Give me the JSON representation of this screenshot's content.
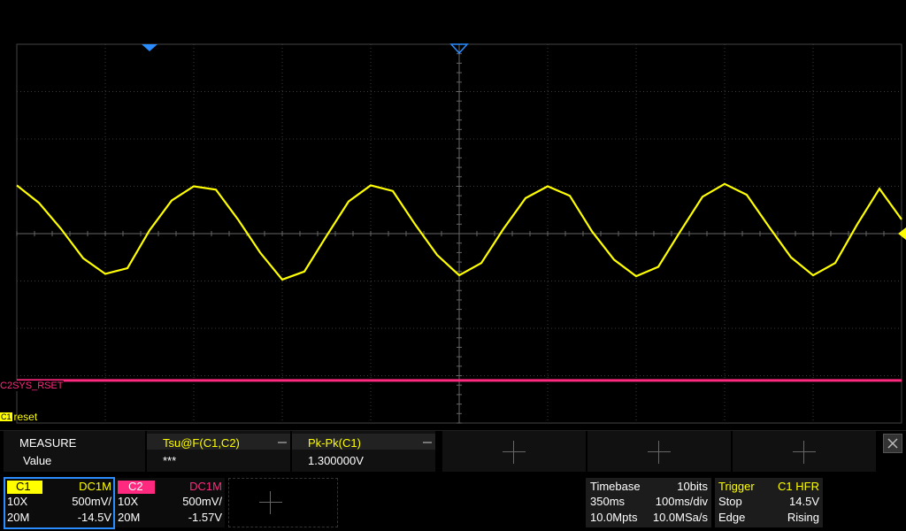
{
  "screen": {
    "accent_c1": "#ffff00",
    "accent_c2": "#ff2a7f",
    "c2_label": "SYS_RSET",
    "c2_marker": "C2",
    "c1_marker": "C1",
    "c1_label": "reset",
    "trigger_marker_icon": "triangle-down-icon",
    "position_marker_icon": "triangle-outline-down-icon"
  },
  "measure": {
    "row1_label": "MEASURE",
    "row2_label": "Value",
    "items": [
      {
        "name": "Tsu@F(C1,C2)",
        "value": "***"
      },
      {
        "name": "Pk-Pk(C1)",
        "value": "1.300000V"
      }
    ]
  },
  "channels": [
    {
      "name": "C1",
      "coupling": "DC1M",
      "probe": "10X",
      "scale": "500mV/",
      "bw": "20M",
      "offset": "-14.5V",
      "color": "#ffff00"
    },
    {
      "name": "C2",
      "coupling": "DC1M",
      "probe": "10X",
      "scale": "500mV/",
      "bw": "20M",
      "offset": "-1.57V",
      "color": "#ff2a7f"
    }
  ],
  "timebase": {
    "title": "Timebase",
    "bits": "10bits",
    "delay": "350ms",
    "scale": "100ms/div",
    "points": "10.0Mpts",
    "rate": "10.0MSa/s"
  },
  "trigger": {
    "title": "Trigger",
    "source": "C1 HFR",
    "state": "Stop",
    "level": "14.5V",
    "type": "Edge",
    "slope": "Rising"
  },
  "chart_data": {
    "type": "line",
    "title": "",
    "xlabel": "",
    "ylabel": "",
    "x_divisions": 10,
    "y_divisions": 8,
    "grid": true,
    "series": [
      {
        "x": [
          0,
          0.25,
          0.5,
          0.75,
          1,
          1.25,
          1.5,
          1.75,
          2,
          2.25,
          2.5,
          2.75,
          3,
          3.25,
          3.5,
          3.75,
          4,
          4.25,
          4.5,
          4.75,
          5,
          5.25,
          5.5,
          5.75,
          6,
          6.25,
          6.5,
          6.75,
          7,
          7.25,
          7.5,
          7.75,
          8,
          8.25,
          8.5,
          8.75,
          9,
          9.25,
          9.5,
          9.75,
          10
        ],
        "values": [
          1.02,
          0.65,
          0.1,
          -0.52,
          -0.85,
          -0.73,
          0.07,
          0.7,
          1.0,
          0.93,
          0.3,
          -0.4,
          -0.97,
          -0.8,
          -0.05,
          0.68,
          1.02,
          0.9,
          0.2,
          -0.45,
          -0.88,
          -0.62,
          0.1,
          0.75,
          1.0,
          0.8,
          0.05,
          -0.55,
          -0.9,
          -0.7,
          0.05,
          0.78,
          1.05,
          0.82,
          0.15,
          -0.5,
          -0.88,
          -0.62,
          0.2,
          0.95,
          0.3
        ]
      },
      {
        "x": [
          0,
          10
        ],
        "values": [
          -3.1,
          -3.1
        ]
      }
    ]
  }
}
